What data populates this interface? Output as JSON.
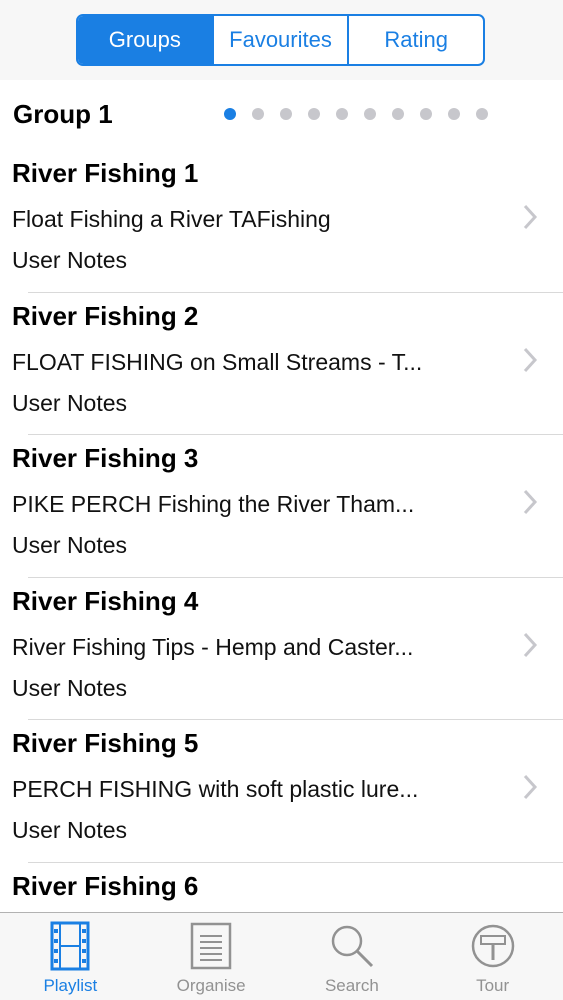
{
  "segmented": {
    "items": [
      {
        "label": "Groups",
        "active": true
      },
      {
        "label": "Favourites",
        "active": false
      },
      {
        "label": "Rating",
        "active": false
      }
    ]
  },
  "group": {
    "title": "Group 1",
    "page_dots": 10,
    "current_page": 1
  },
  "list": [
    {
      "title": "River Fishing 1",
      "subtitle": "Float Fishing a River  TAFishing",
      "notes": "User Notes"
    },
    {
      "title": "River Fishing 2",
      "subtitle": "FLOAT FISHING on Small Streams - T...",
      "notes": "User Notes"
    },
    {
      "title": "River Fishing 3",
      "subtitle": "PIKE  PERCH Fishing the River Tham...",
      "notes": "User Notes"
    },
    {
      "title": "River Fishing 4",
      "subtitle": "River Fishing Tips - Hemp and Caster...",
      "notes": "User Notes"
    },
    {
      "title": "River Fishing 5",
      "subtitle": "PERCH FISHING with soft plastic lure...",
      "notes": "User Notes"
    },
    {
      "title": "River Fishing 6"
    }
  ],
  "tabbar": {
    "items": [
      {
        "label": "Playlist",
        "icon": "film-strip-icon",
        "active": true
      },
      {
        "label": "Organise",
        "icon": "cabinet-icon",
        "active": false
      },
      {
        "label": "Search",
        "icon": "search-icon",
        "active": false
      },
      {
        "label": "Tour",
        "icon": "signpost-icon",
        "active": false
      }
    ]
  },
  "colors": {
    "accent": "#1a7fe3",
    "inactive": "#929292",
    "separator": "#d9d9d9"
  }
}
